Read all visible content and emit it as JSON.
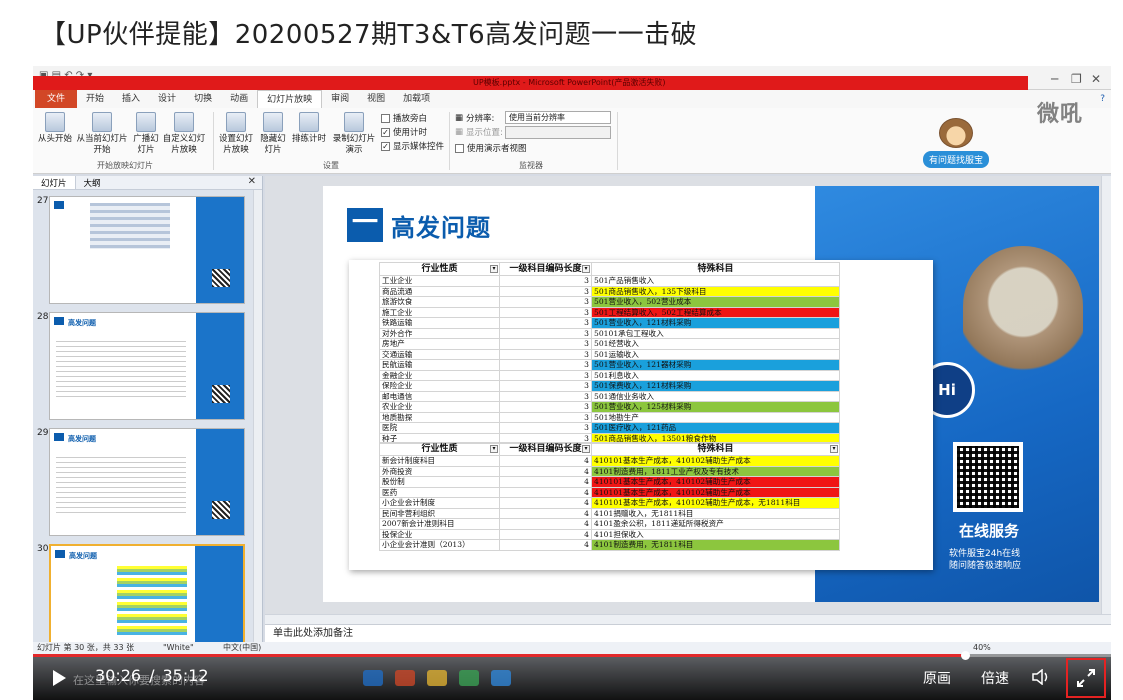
{
  "page": {
    "title": "【UP伙伴提能】20200527期T3&T6高发问题一一击破"
  },
  "ppt": {
    "window_title": "UP模板.pptx - Microsoft PowerPoint(产品激活失败)",
    "tabs": [
      "文件",
      "开始",
      "插入",
      "设计",
      "切换",
      "动画",
      "幻灯片放映",
      "审阅",
      "视图",
      "加载项"
    ],
    "active_tab": "幻灯片放映",
    "ribbon": {
      "btn_from_start": "从头开始",
      "btn_from_current": "从当前幻灯片开始",
      "btn_broadcast": "广播幻灯片",
      "btn_custom": "自定义幻灯片放映",
      "group_start": "开始放映幻灯片",
      "btn_setup": "设置幻灯片放映",
      "btn_hide": "隐藏幻灯片",
      "btn_rehearse": "排练计时",
      "btn_record": "录制幻灯片演示",
      "chk_narration": "播放旁白",
      "chk_timings": "使用计时",
      "chk_media": "显示媒体控件",
      "group_setup": "设置",
      "resolution_label": "分辨率:",
      "resolution_value": "使用当前分辨率",
      "display_label": "显示位置:",
      "chk_presenter": "使用演示者视图",
      "group_monitor": "监视器"
    },
    "watermark": "微吼",
    "mascot_tag": "有问题找服宝",
    "panel_tabs": [
      "幻灯片",
      "大纲"
    ],
    "thumbnails": [
      {
        "num": "27",
        "title": "",
        "selected": false
      },
      {
        "num": "28",
        "title": "高发问题",
        "selected": false
      },
      {
        "num": "29",
        "title": "高发问题",
        "selected": false
      },
      {
        "num": "30",
        "title": "高发问题",
        "selected": true
      }
    ],
    "notes_placeholder": "单击此处添加备注",
    "status": {
      "slide_info": "幻灯片 第 30 张，共 33 张",
      "theme": "\"White\"",
      "language": "中文(中国)",
      "zoom": "40%"
    }
  },
  "slide": {
    "title_box": "一",
    "title": "高发问题",
    "hi": "Hi",
    "online_title": "在线服务",
    "online_sub1": "软件服宝24h在线",
    "online_sub2": "随问随答极速响应",
    "table1": {
      "headers": [
        "行业性质",
        "一级科目编码长度",
        "特殊科目"
      ],
      "rows": [
        {
          "c1": "工业企业",
          "c2": "3",
          "c3": "501产品销售收入",
          "color": ""
        },
        {
          "c1": "商品流通",
          "c2": "3",
          "c3": "501商品销售收入，135下级科目",
          "color": "yellow"
        },
        {
          "c1": "旅游饮食",
          "c2": "3",
          "c3": "501营业收入，502营业成本",
          "color": "green"
        },
        {
          "c1": "施工企业",
          "c2": "3",
          "c3": "501工程结算收入，502工程结算成本",
          "color": "red"
        },
        {
          "c1": "铁路运输",
          "c2": "3",
          "c3": "501营业收入，121材料采购",
          "color": "blue"
        },
        {
          "c1": "对外合作",
          "c2": "3",
          "c3": "50101承包工程收入",
          "color": ""
        },
        {
          "c1": "房地产",
          "c2": "3",
          "c3": "501经营收入",
          "color": ""
        },
        {
          "c1": "交通运输",
          "c2": "3",
          "c3": "501运输收入",
          "color": ""
        },
        {
          "c1": "民航运输",
          "c2": "3",
          "c3": "501营业收入，121器材采购",
          "color": "blue"
        },
        {
          "c1": "金融企业",
          "c2": "3",
          "c3": "501利息收入",
          "color": ""
        },
        {
          "c1": "保险企业",
          "c2": "3",
          "c3": "501保费收入，121材料采购",
          "color": "blue"
        },
        {
          "c1": "邮电通信",
          "c2": "3",
          "c3": "501通信业务收入",
          "color": ""
        },
        {
          "c1": "农业企业",
          "c2": "3",
          "c3": "501营业收入，125材料采购",
          "color": "green"
        },
        {
          "c1": "地质勘探",
          "c2": "3",
          "c3": "501地勘生产",
          "color": ""
        },
        {
          "c1": "医院",
          "c2": "3",
          "c3": "501医疗收入，121药品",
          "color": "blue"
        },
        {
          "c1": "种子",
          "c2": "3",
          "c3": "501商品销售收入，13501粮食作物",
          "color": "yellow"
        }
      ]
    },
    "table2": {
      "headers": [
        "行业性质",
        "一级科目编码长度",
        "特殊科目"
      ],
      "rows": [
        {
          "c1": "新会计制度科目",
          "c2": "4",
          "c3": "410101基本生产成本，410102辅助生产成本",
          "color": "yellow"
        },
        {
          "c1": "外商投资",
          "c2": "4",
          "c3": "4101制造费用，1811工业产权及专有技术",
          "color": "green"
        },
        {
          "c1": "股份制",
          "c2": "4",
          "c3": "410101基本生产成本，410102辅助生产成本",
          "color": "red"
        },
        {
          "c1": "医药",
          "c2": "4",
          "c3": "410101基本生产成本，410102辅助生产成本",
          "color": "red"
        },
        {
          "c1": "小企业会计制度",
          "c2": "4",
          "c3": "410101基本生产成本，410102辅助生产成本，无1811科目",
          "color": "yellow"
        },
        {
          "c1": "民间非营利组织",
          "c2": "4",
          "c3": "4101捐赠收入，无1811科目",
          "color": ""
        },
        {
          "c1": "2007新会计准则科目",
          "c2": "4",
          "c3": "4101盈余公积，1811递延所得税资产",
          "color": ""
        },
        {
          "c1": "投保企业",
          "c2": "4",
          "c3": "4101担保收入",
          "color": ""
        },
        {
          "c1": "小企业会计准则（2013）",
          "c2": "4",
          "c3": "4101制造费用，无1811科目",
          "color": "green"
        }
      ]
    }
  },
  "player": {
    "current_time": "30:26",
    "separator": "/",
    "duration": "35:12",
    "progress": 0.8646,
    "btn_original": "原画",
    "btn_speed": "倍速",
    "taskbar_ghost": "在这里输入你要搜索的内容"
  },
  "colors": {
    "accent_red": "#e3292b",
    "ppt_blue": "#0b5cad",
    "highlight_yellow": "#ffff00",
    "highlight_green": "#8cc63e",
    "highlight_red": "#f01515",
    "highlight_blue": "#1aa0dc"
  },
  "icons": [
    "play-icon",
    "volume-icon",
    "fullscreen-icon",
    "close-icon",
    "maximize-icon",
    "minimize-icon",
    "help-icon"
  ]
}
